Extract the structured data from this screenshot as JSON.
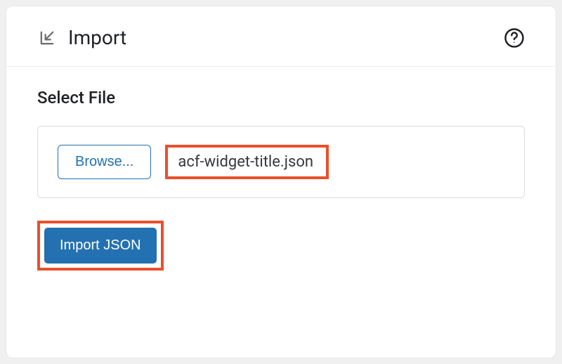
{
  "header": {
    "title": "Import"
  },
  "body": {
    "section_label": "Select File",
    "browse_label": "Browse...",
    "selected_filename": "acf-widget-title.json",
    "import_button_label": "Import JSON"
  },
  "colors": {
    "highlight": "#e8502c",
    "primary": "#2371b1"
  }
}
